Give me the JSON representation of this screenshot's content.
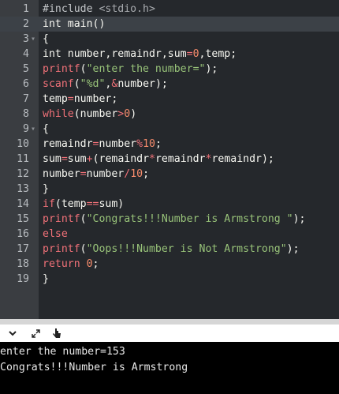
{
  "editor": {
    "lines": [
      {
        "n": "1",
        "fold": false,
        "tokens": [
          [
            "pp",
            "#include "
          ],
          [
            "pth",
            "<stdio.h>"
          ]
        ]
      },
      {
        "n": "2",
        "fold": false,
        "active": true,
        "tokens": [
          [
            "",
            "int main()"
          ]
        ]
      },
      {
        "n": "3",
        "fold": true,
        "tokens": [
          [
            "",
            "{"
          ]
        ]
      },
      {
        "n": "4",
        "fold": false,
        "tokens": [
          [
            "",
            "int number,remaindr,sum"
          ],
          [
            "op",
            "="
          ],
          [
            "num",
            "0"
          ],
          [
            "",
            ",temp;"
          ]
        ]
      },
      {
        "n": "5",
        "fold": false,
        "tokens": [
          [
            "fn",
            "printf"
          ],
          [
            "",
            "("
          ],
          [
            "str",
            "\"enter the number=\""
          ],
          [
            "",
            ");"
          ]
        ]
      },
      {
        "n": "6",
        "fold": false,
        "tokens": [
          [
            "fn",
            "scanf"
          ],
          [
            "",
            "("
          ],
          [
            "str",
            "\"%d\""
          ],
          [
            "",
            ","
          ],
          [
            "op",
            "&"
          ],
          [
            "",
            "number);"
          ]
        ]
      },
      {
        "n": "7",
        "fold": false,
        "tokens": [
          [
            "",
            "temp"
          ],
          [
            "op",
            "="
          ],
          [
            "",
            "number;"
          ]
        ]
      },
      {
        "n": "8",
        "fold": false,
        "tokens": [
          [
            "kw",
            "while"
          ],
          [
            "",
            "(number"
          ],
          [
            "op",
            ">"
          ],
          [
            "num",
            "0"
          ],
          [
            "",
            ")"
          ]
        ]
      },
      {
        "n": "9",
        "fold": true,
        "tokens": [
          [
            "",
            "{"
          ]
        ]
      },
      {
        "n": "10",
        "fold": false,
        "tokens": [
          [
            "",
            "remaindr"
          ],
          [
            "op",
            "="
          ],
          [
            "",
            "number"
          ],
          [
            "op",
            "%"
          ],
          [
            "num",
            "10"
          ],
          [
            "",
            ";"
          ]
        ]
      },
      {
        "n": "11",
        "fold": false,
        "tokens": [
          [
            "",
            "sum"
          ],
          [
            "op",
            "="
          ],
          [
            "",
            "sum"
          ],
          [
            "op",
            "+"
          ],
          [
            "",
            "(remaindr"
          ],
          [
            "op",
            "*"
          ],
          [
            "",
            "remaindr"
          ],
          [
            "op",
            "*"
          ],
          [
            "",
            "remaindr);"
          ]
        ]
      },
      {
        "n": "12",
        "fold": false,
        "tokens": [
          [
            "",
            "number"
          ],
          [
            "op",
            "="
          ],
          [
            "",
            "number"
          ],
          [
            "op",
            "/"
          ],
          [
            "num",
            "10"
          ],
          [
            "",
            ";"
          ]
        ]
      },
      {
        "n": "13",
        "fold": false,
        "tokens": [
          [
            "",
            "}"
          ]
        ]
      },
      {
        "n": "14",
        "fold": false,
        "tokens": [
          [
            "kw",
            "if"
          ],
          [
            "",
            "(temp"
          ],
          [
            "op",
            "=="
          ],
          [
            "",
            "sum)"
          ]
        ]
      },
      {
        "n": "15",
        "fold": false,
        "tokens": [
          [
            "fn",
            "printf"
          ],
          [
            "",
            "("
          ],
          [
            "str",
            "\"Congrats!!!Number is Armstrong \""
          ],
          [
            "",
            ");"
          ]
        ]
      },
      {
        "n": "16",
        "fold": false,
        "tokens": [
          [
            "kw",
            "else"
          ]
        ]
      },
      {
        "n": "17",
        "fold": false,
        "tokens": [
          [
            "fn",
            "printf"
          ],
          [
            "",
            "("
          ],
          [
            "str",
            "\"Oops!!!Number is Not Armstrong\""
          ],
          [
            "",
            ");"
          ]
        ]
      },
      {
        "n": "18",
        "fold": false,
        "tokens": [
          [
            "kw",
            "return "
          ],
          [
            "num",
            "0"
          ],
          [
            "",
            ";"
          ]
        ]
      },
      {
        "n": "19",
        "fold": false,
        "tokens": [
          [
            "",
            "}"
          ]
        ]
      }
    ]
  },
  "toolbar": {
    "icons": [
      "chevron-down-icon",
      "expand-icon",
      "pointer-icon"
    ]
  },
  "console": {
    "lines": [
      "enter the number=153",
      "Congrats!!!Number is Armstrong"
    ]
  }
}
